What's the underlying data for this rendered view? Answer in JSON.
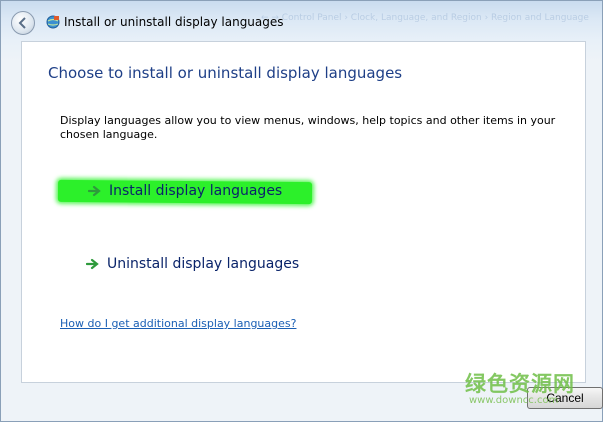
{
  "window": {
    "title": "Install or uninstall display languages",
    "faded_breadcrumb": "← →  Control Panel › Clock, Language, and Region › Region and Language"
  },
  "main": {
    "heading": "Choose to install or uninstall display languages",
    "description": "Display languages allow you to view menus, windows, help topics and other items in your chosen language.",
    "tasks": [
      {
        "label": "Install display languages",
        "highlighted": true
      },
      {
        "label": "Uninstall display languages",
        "highlighted": false
      }
    ],
    "help_link": "How do I get additional display languages?"
  },
  "footer": {
    "cancel_label": "Cancel"
  },
  "watermark": {
    "text": "绿色资源网",
    "url": "www.downcc.com"
  },
  "colors": {
    "heading": "#1e3f87",
    "highlight": "#2cf02a",
    "link": "#1a5fb4",
    "arrow": "#2e9a3c"
  },
  "icons": {
    "back": "back-arrow-icon",
    "title": "language-globe-icon",
    "task_arrow": "green-arrow-icon"
  }
}
